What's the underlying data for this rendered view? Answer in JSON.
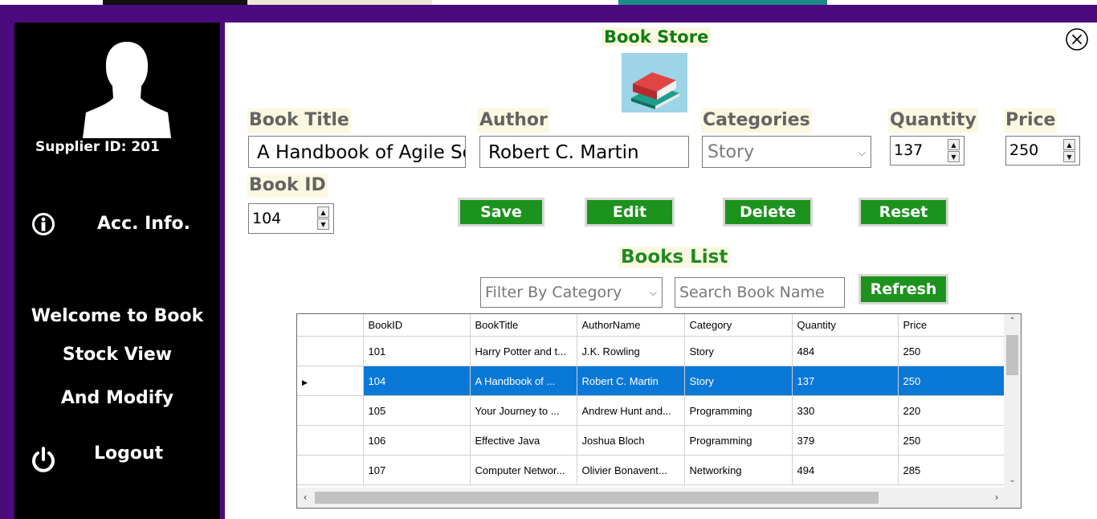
{
  "sidebar": {
    "supplier_id": "Supplier ID: 201",
    "acc_info": "Acc. Info.",
    "welcome_lines": [
      "Welcome to Book",
      "Stock View",
      "And Modify"
    ],
    "logout": "Logout",
    "icons": [
      "user-avatar-icon",
      "info-icon",
      "power-icon"
    ]
  },
  "header": {
    "title": "Book Store",
    "logo_icon": "books-icon",
    "close_icon": "close-circle-icon"
  },
  "form": {
    "book_title_label": "Book Title",
    "book_title_value": "A Handbook of Agile Software Craftsmanship",
    "author_label": "Author",
    "author_value": "Robert C. Martin",
    "categories_label": "Categories",
    "categories_value": "Story",
    "quantity_label": "Quantity",
    "quantity_value": "137",
    "price_label": "Price",
    "price_value": "250",
    "book_id_label": "Book ID",
    "book_id_value": "104"
  },
  "actions": {
    "save": "Save",
    "edit": "Edit",
    "delete": "Delete",
    "reset": "Reset"
  },
  "list": {
    "title": "Books List",
    "filter_placeholder": "Filter By Category",
    "search_placeholder": "Search Book Name",
    "refresh": "Refresh",
    "columns": [
      "BookID",
      "BookTitle",
      "AuthorName",
      "Category",
      "Quantity",
      "Price"
    ],
    "rows": [
      {
        "id": "101",
        "title": "Harry Potter and t...",
        "author": "J.K. Rowling",
        "category": "Story",
        "quantity": "484",
        "price": "250"
      },
      {
        "id": "104",
        "title": "A Handbook of ...",
        "author": "Robert C. Martin",
        "category": "Story",
        "quantity": "137",
        "price": "250",
        "selected": true
      },
      {
        "id": "105",
        "title": "Your Journey to ...",
        "author": "Andrew Hunt and...",
        "category": "Programming",
        "quantity": "330",
        "price": "220"
      },
      {
        "id": "106",
        "title": "Effective Java",
        "author": "Joshua Bloch",
        "category": "Programming",
        "quantity": "379",
        "price": "250"
      },
      {
        "id": "107",
        "title": "Computer Networ...",
        "author": "Olivier Bonavent...",
        "category": "Networking",
        "quantity": "494",
        "price": "285"
      }
    ]
  },
  "colors": {
    "frame": "#4b0a7d",
    "sidebar": "#000000",
    "button_green": "#1c931c",
    "title_green": "#0f7d0f",
    "label_bg": "#fbf8e1",
    "selection_blue": "#0a78d7"
  }
}
